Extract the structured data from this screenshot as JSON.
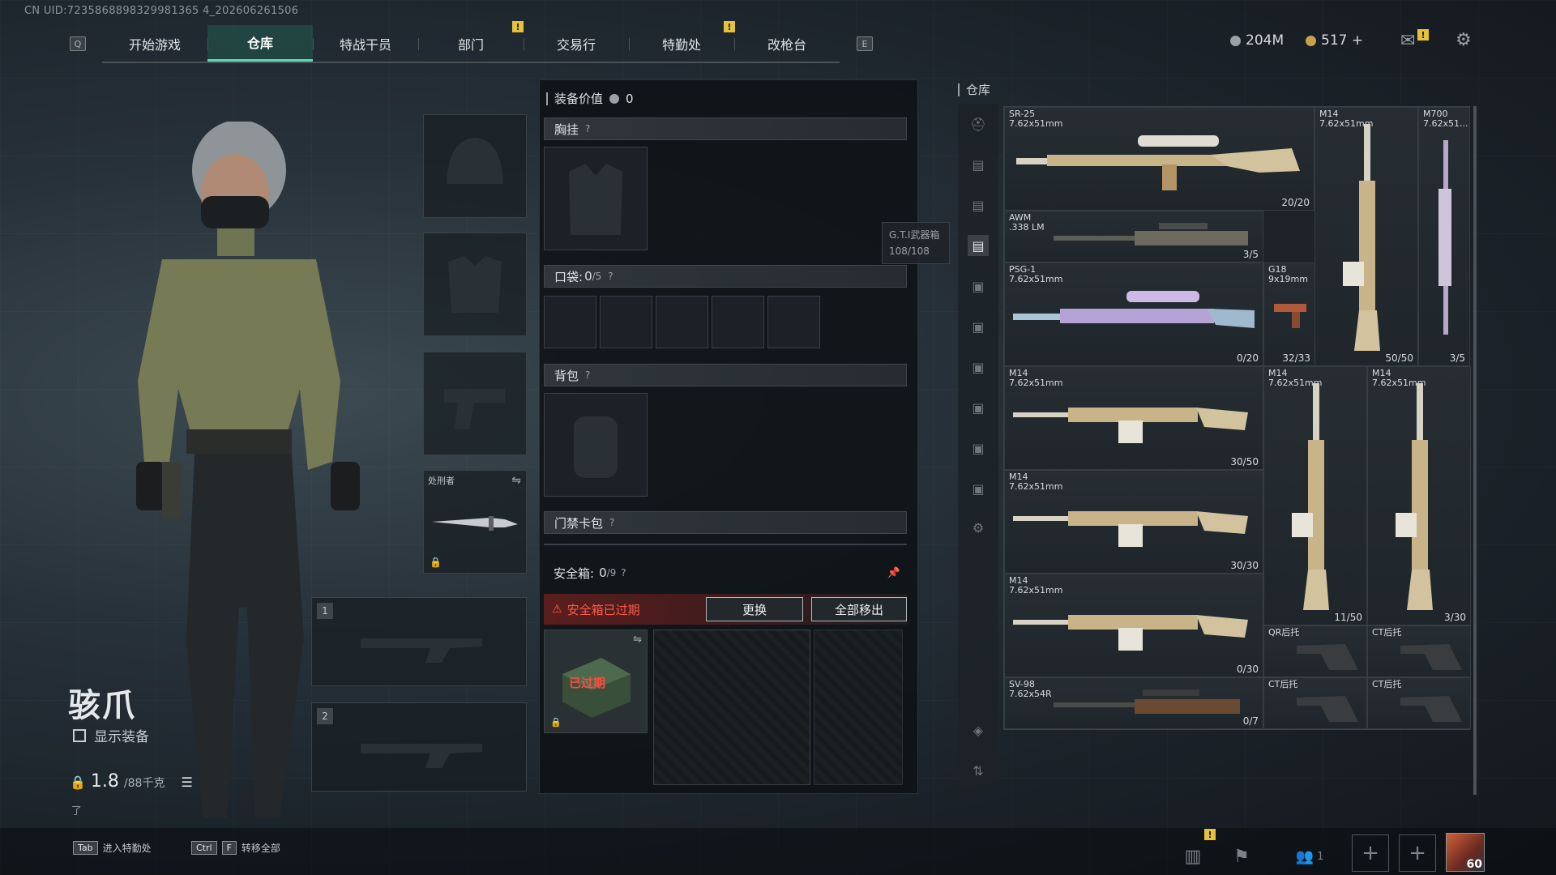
{
  "header": {
    "uid": "CN UID:7235868898329981365 4_202606261506",
    "tabs": [
      {
        "key": "Q",
        "label": ""
      },
      {
        "label": "开始游戏"
      },
      {
        "label": "仓库",
        "active": true
      },
      {
        "label": "特战干员"
      },
      {
        "label": "部门"
      },
      {
        "label": "交易行"
      },
      {
        "label": "特勤处"
      },
      {
        "label": "改枪台"
      }
    ],
    "tab_labels": [
      "开始游戏",
      "仓库",
      "特战干员",
      "部门",
      "交易行",
      "特勤处",
      "改枪台"
    ],
    "key_left": "Q",
    "key_right": "E",
    "alert_mark": "!",
    "currency_silver": "204M",
    "currency_gold": "517 +"
  },
  "character": {
    "name": "骇爪",
    "show_equipment_label": "显示装备",
    "weight_current": "1.8",
    "weight_max": "/88千克",
    "weight_note": "了"
  },
  "equip_slots": {
    "melee_name": "处刑者",
    "slot1": "1",
    "slot2": "2"
  },
  "loadout": {
    "value_label": "装备价值",
    "value": "0",
    "chest_rig": "胸挂",
    "pockets": "口袋:",
    "pockets_count": "0",
    "pockets_cap": "/5",
    "backpack": "背包",
    "access_card": "门禁卡包",
    "safe_box": "安全箱:",
    "safe_box_count": "0",
    "safe_box_cap": "/9",
    "expired_warning": "安全箱已过期",
    "replace_button": "更换",
    "move_all_button": "全部移出",
    "expired_tag": "已过期",
    "help": "?",
    "tooltip_title": "G.T.I武器箱",
    "tooltip_value": "108/108"
  },
  "warehouse": {
    "title": "仓库",
    "items": [
      {
        "name": "SR-25\n7.62x51mm",
        "count": "20/20"
      },
      {
        "name": "M14\n7.62x51mm",
        "count": "50/50"
      },
      {
        "name": "M700\n7.62x51...",
        "count": "3/5"
      },
      {
        "name": "AWM\n.338 LM",
        "count": "3/5"
      },
      {
        "name": "PSG-1\n7.62x51mm",
        "count": "0/20"
      },
      {
        "name": "G18\n9x19mm",
        "count": "32/33"
      },
      {
        "name": "M14\n7.62x51mm",
        "count": "30/50"
      },
      {
        "name": "M14\n7.62x51mm",
        "count": "11/50"
      },
      {
        "name": "M14\n7.62x51mm",
        "count": "3/30"
      },
      {
        "name": "M14\n7.62x51mm",
        "count": "30/30"
      },
      {
        "name": "M14\n7.62x51mm",
        "count": "0/30"
      },
      {
        "name": "QR后托",
        "count": ""
      },
      {
        "name": "CT后托",
        "count": ""
      },
      {
        "name": "SV-98\n7.62x54R",
        "count": "0/7"
      },
      {
        "name": "CT后托",
        "count": ""
      },
      {
        "name": "CT后托",
        "count": ""
      }
    ]
  },
  "footer": {
    "hint1_key": "Tab",
    "hint1_label": "进入特勤处",
    "hint2_key1": "Ctrl",
    "hint2_key2": "F",
    "hint2_label": "转移全部",
    "squad_count": "1",
    "level": "60"
  },
  "colors": {
    "accent": "#5fd7b4",
    "warning": "#e0473a",
    "alert": "#e6c23a"
  }
}
